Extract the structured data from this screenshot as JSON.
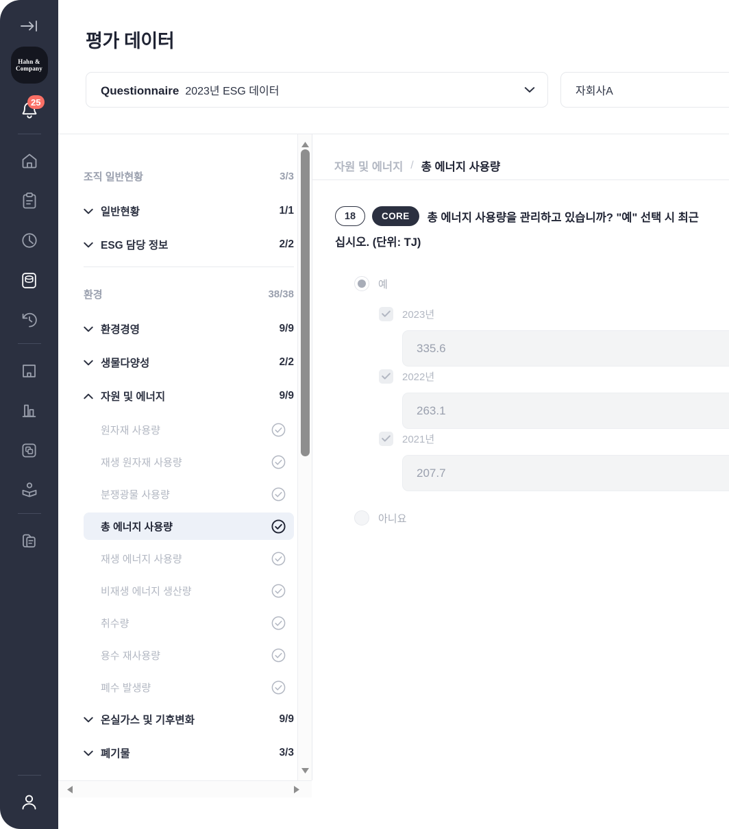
{
  "rail": {
    "collapse_icon": "arrow-right-to-line-icon",
    "logo_text_line1": "Hahn &",
    "logo_text_line2": "Company",
    "notification_count": "25",
    "items": [
      {
        "name": "bell-icon"
      },
      {
        "name": "home-icon"
      },
      {
        "name": "clipboard-icon"
      },
      {
        "name": "clock-icon"
      },
      {
        "name": "database-icon"
      },
      {
        "name": "history-icon"
      },
      {
        "name": "bookmark-icon"
      },
      {
        "name": "bar-chart-icon"
      },
      {
        "name": "layers-box-icon"
      },
      {
        "name": "open-book-icon"
      },
      {
        "name": "documents-icon"
      },
      {
        "name": "user-icon"
      }
    ]
  },
  "header": {
    "title": "평가 데이터",
    "questionnaire_label": "Questionnaire",
    "questionnaire_value": "2023년 ESG 데이터",
    "subsidiary_value": "자회사A",
    "chevron_icon": "chevron-down-icon"
  },
  "tree": {
    "groups": [
      {
        "label": "조직 일반현황",
        "count": "3/3",
        "categories": [
          {
            "label": "일반현황",
            "count": "1/1",
            "expanded": false,
            "items": []
          },
          {
            "label": "ESG 담당 정보",
            "count": "2/2",
            "expanded": false,
            "items": []
          }
        ]
      },
      {
        "label": "환경",
        "count": "38/38",
        "categories": [
          {
            "label": "환경경영",
            "count": "9/9",
            "expanded": false,
            "items": []
          },
          {
            "label": "생물다양성",
            "count": "2/2",
            "expanded": false,
            "items": []
          },
          {
            "label": "자원 및 에너지",
            "count": "9/9",
            "expanded": true,
            "items": [
              {
                "label": "원자재 사용량",
                "selected": false
              },
              {
                "label": "재생 원자재 사용량",
                "selected": false
              },
              {
                "label": "분쟁광물 사용량",
                "selected": false
              },
              {
                "label": "총 에너지 사용량",
                "selected": true
              },
              {
                "label": "재생 에너지 사용량",
                "selected": false
              },
              {
                "label": "비재생 에너지 생산량",
                "selected": false
              },
              {
                "label": "취수량",
                "selected": false
              },
              {
                "label": "용수 재사용량",
                "selected": false
              },
              {
                "label": "폐수 발생량",
                "selected": false
              }
            ]
          },
          {
            "label": "온실가스 및 기후변화",
            "count": "9/9",
            "expanded": false,
            "items": []
          },
          {
            "label": "폐기물",
            "count": "3/3",
            "expanded": false,
            "items": []
          }
        ]
      }
    ],
    "scroll": {
      "up_arrow_icon": "triangle-up-icon",
      "down_arrow_icon": "triangle-down-icon",
      "left_arrow_icon": "triangle-left-icon",
      "right_arrow_icon": "triangle-right-icon"
    }
  },
  "content": {
    "breadcrumb_parent": "자원 및 에너지",
    "breadcrumb_sep": "/",
    "breadcrumb_current": "총 에너지 사용량",
    "question": {
      "number": "18",
      "tag": "CORE",
      "text_line1": "총 에너지 사용량을 관리하고 있습니까? \"예\" 선택 시 최근",
      "text_line2": "십시오. (단위: TJ)"
    },
    "answers": {
      "yes_label": "예",
      "no_label": "아니요",
      "years": [
        {
          "label": "2023년",
          "value": "335.6",
          "checked": true
        },
        {
          "label": "2022년",
          "value": "263.1",
          "checked": true
        },
        {
          "label": "2021년",
          "value": "207.7",
          "checked": true
        }
      ]
    }
  },
  "colors": {
    "rail_bg": "#2b3040",
    "badge": "#fb7066",
    "selected_row": "#edf1f8",
    "input_bg": "#f3f4f5",
    "text_dark": "#1f2333",
    "text_muted": "#b2b7c2"
  }
}
